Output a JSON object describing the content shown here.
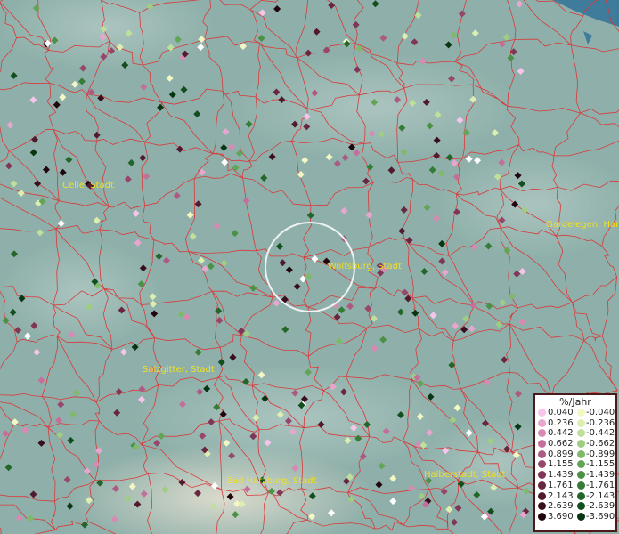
{
  "map": {
    "places": [
      {
        "name": "Celle, Stadt",
        "key": "celle"
      },
      {
        "name": "Wolfsburg, Stadt",
        "key": "wolfsburg"
      },
      {
        "name": "Gardelegen, Han",
        "key": "gardelegen"
      },
      {
        "name": "Salzgitter, Stadt",
        "key": "salzgitter"
      },
      {
        "name": "Bad Harzburg, Stadt",
        "key": "badharzburg"
      },
      {
        "name": "Halberstadt, Stadt",
        "key": "halberstadt"
      }
    ],
    "colors": {
      "background": "#8fb0aa",
      "borders": "#d83a3a",
      "labels": "#f0e020",
      "selection_circle": "#ffffff"
    }
  },
  "legend": {
    "title": "%/Jahr",
    "rows": [
      {
        "pos": "0.040",
        "neg": "-0.040",
        "pos_color": "#f7c4ea",
        "neg_color": "#f2f7c4"
      },
      {
        "pos": "0.236",
        "neg": "-0.236",
        "pos_color": "#e8a6cf",
        "neg_color": "#dcefb0"
      },
      {
        "pos": "0.442",
        "neg": "-0.442",
        "pos_color": "#d78ab4",
        "neg_color": "#bfe09a"
      },
      {
        "pos": "0.662",
        "neg": "-0.662",
        "pos_color": "#c36f99",
        "neg_color": "#9fcd82"
      },
      {
        "pos": "0.899",
        "neg": "-0.899",
        "pos_color": "#ad5a82",
        "neg_color": "#7fb96a"
      },
      {
        "pos": "1.155",
        "neg": "-1.155",
        "pos_color": "#97476c",
        "neg_color": "#63a556"
      },
      {
        "pos": "1.439",
        "neg": "-1.439",
        "pos_color": "#803656",
        "neg_color": "#4a9145"
      },
      {
        "pos": "1.761",
        "neg": "-1.761",
        "pos_color": "#692640",
        "neg_color": "#357c36"
      },
      {
        "pos": "2.143",
        "neg": "-2.143",
        "pos_color": "#521a2e",
        "neg_color": "#22662a"
      },
      {
        "pos": "2.639",
        "neg": "-2.639",
        "pos_color": "#3a0f1d",
        "neg_color": "#134e1e"
      },
      {
        "pos": "3.690",
        "neg": "-3.690",
        "pos_color": "#22060e",
        "neg_color": "#083612"
      }
    ]
  }
}
